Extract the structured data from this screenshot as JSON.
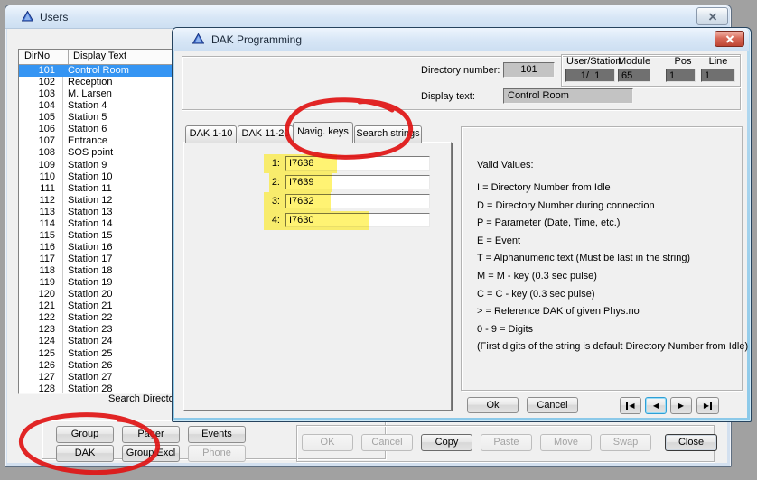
{
  "colors": {
    "selection_blue": "#3595f3",
    "highlight_yellow": "#ffe900",
    "annotation_red": "#e01414",
    "readonly_gray": "#c3c3c3",
    "dark_field_gray": "#707070"
  },
  "users_window": {
    "title": "Users",
    "list": {
      "columns": [
        "DirNo",
        "Display Text"
      ],
      "selected_index": 0,
      "rows": [
        [
          "101",
          "Control Room"
        ],
        [
          "102",
          "Reception"
        ],
        [
          "103",
          "M. Larsen"
        ],
        [
          "104",
          "Station 4"
        ],
        [
          "105",
          "Station 5"
        ],
        [
          "106",
          "Station 6"
        ],
        [
          "107",
          "Entrance"
        ],
        [
          "108",
          "SOS point"
        ],
        [
          "109",
          "Station 9"
        ],
        [
          "110",
          "Station 10"
        ],
        [
          "111",
          "Station 11"
        ],
        [
          "112",
          "Station 12"
        ],
        [
          "113",
          "Station 13"
        ],
        [
          "114",
          "Station 14"
        ],
        [
          "115",
          "Station 15"
        ],
        [
          "116",
          "Station 16"
        ],
        [
          "117",
          "Station 17"
        ],
        [
          "118",
          "Station 18"
        ],
        [
          "119",
          "Station 19"
        ],
        [
          "120",
          "Station 20"
        ],
        [
          "121",
          "Station 21"
        ],
        [
          "122",
          "Station 22"
        ],
        [
          "123",
          "Station 23"
        ],
        [
          "124",
          "Station 24"
        ],
        [
          "125",
          "Station 25"
        ],
        [
          "126",
          "Station 26"
        ],
        [
          "127",
          "Station 27"
        ],
        [
          "128",
          "Station 28"
        ]
      ]
    },
    "search_label": "Search Director",
    "tool_buttons": [
      {
        "label": "Group",
        "enabled": true
      },
      {
        "label": "Pager",
        "enabled": true
      },
      {
        "label": "Events",
        "enabled": true
      },
      {
        "label": "DAK",
        "enabled": true
      },
      {
        "label": "Group Excl",
        "enabled": true
      },
      {
        "label": "Phone",
        "enabled": false
      }
    ],
    "action_buttons": [
      {
        "label": "OK",
        "enabled": false
      },
      {
        "label": "Cancel",
        "enabled": false
      },
      {
        "label": "Copy",
        "enabled": true
      },
      {
        "label": "Paste",
        "enabled": false
      },
      {
        "label": "Move",
        "enabled": false
      },
      {
        "label": "Swap",
        "enabled": false
      },
      {
        "label": "Close",
        "enabled": true
      }
    ]
  },
  "dak_dialog": {
    "title": "DAK Programming",
    "directory_number_label": "Directory number:",
    "directory_number": "101",
    "display_text_label": "Display text:",
    "display_text": "Control Room",
    "station_headers": [
      "User/Station",
      "Module",
      "Pos",
      "Line"
    ],
    "station_values": [
      "1/  1",
      "65",
      "1",
      "1"
    ],
    "tabs": [
      "DAK 1-10",
      "DAK 11-20",
      "Navig. keys",
      "Search strings"
    ],
    "active_tab": "Navig. keys",
    "nav_keys": [
      {
        "label": "1:",
        "value": "I7638"
      },
      {
        "label": "2:",
        "value": "I7639"
      },
      {
        "label": "3:",
        "value": "I7632"
      },
      {
        "label": "4:",
        "value": "I7630"
      }
    ],
    "valid_values": {
      "title": "Valid Values:",
      "items": [
        "I = Directory Number from Idle",
        "D = Directory Number during connection",
        "P = Parameter (Date, Time, etc.)",
        "E = Event",
        "T = Alphanumeric text (Must be last in the string)",
        "M = M - key (0.3 sec pulse)",
        "C = C - key (0.3 sec pulse)",
        "> = Reference DAK of given Phys.no",
        "0 - 9 = Digits",
        "(First digits of the string is default Directory Number from Idle)"
      ]
    },
    "ok_label": "Ok",
    "cancel_label": "Cancel",
    "record_nav": [
      {
        "name": "first",
        "glyph": "◀"
      },
      {
        "name": "previous",
        "glyph": "◀",
        "focused": true
      },
      {
        "name": "next",
        "glyph": "▶"
      },
      {
        "name": "last",
        "glyph": "▶"
      }
    ]
  }
}
